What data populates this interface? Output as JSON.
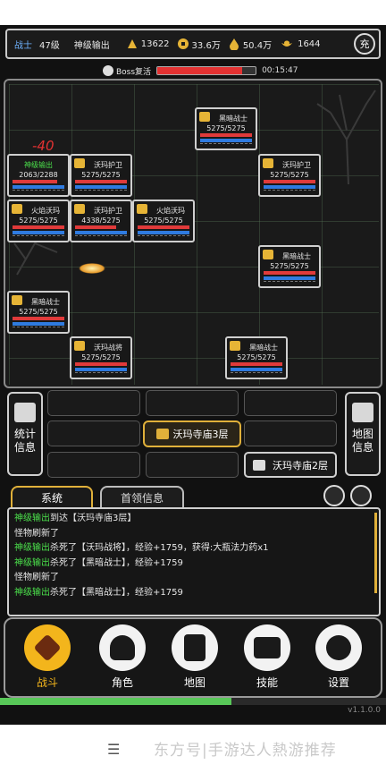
{
  "status": {
    "class": "战士",
    "level": "47级",
    "name": "神级输出",
    "res1": "13622",
    "res2": "33.6万",
    "res3": "50.4万",
    "res4": "1644",
    "auto_label": "充"
  },
  "boss": {
    "label": "Boss复活",
    "progress": 0.86,
    "timer": "00:15:47"
  },
  "damage_text": "-40",
  "units": [
    {
      "name": "黑暗战士",
      "hp": "5275/5275"
    },
    {
      "name": "神级输出",
      "hp": "2063/2288"
    },
    {
      "name": "沃玛护卫",
      "hp": "5275/5275"
    },
    {
      "name": "沃玛护卫",
      "hp": "5275/5275"
    },
    {
      "name": "火焰沃玛",
      "hp": "5275/5275"
    },
    {
      "name": "沃玛护卫",
      "hp": "4338/5275"
    },
    {
      "name": "火焰沃玛",
      "hp": "5275/5275"
    },
    {
      "name": "黑暗战士",
      "hp": "5275/5275"
    },
    {
      "name": "黑暗战士",
      "hp": "5275/5275"
    },
    {
      "name": "沃玛战将",
      "hp": "5275/5275"
    },
    {
      "name": "黑暗战士",
      "hp": "5275/5275"
    }
  ],
  "side": {
    "stats": [
      "统计",
      "信息"
    ],
    "map": [
      "地图",
      "信息"
    ]
  },
  "floors": {
    "current": "沃玛寺庙3层",
    "previous": "沃玛寺庙2层"
  },
  "tabs": [
    "系统",
    "首领信息"
  ],
  "log": [
    {
      "who": "神级输出",
      "text": "到达【沃玛寺庙3层】"
    },
    {
      "who": "",
      "text": "怪物刷新了"
    },
    {
      "who": "神级输出",
      "text": "杀死了【沃玛战将】，经验+1759，获得:大瓶法力药x1"
    },
    {
      "who": "神级输出",
      "text": "杀死了【黑暗战士】，经验+1759"
    },
    {
      "who": "",
      "text": "怪物刷新了"
    },
    {
      "who": "神级输出",
      "text": "杀死了【黑暗战士】，经验+1759"
    }
  ],
  "nav": [
    "战斗",
    "角色",
    "地图",
    "技能",
    "设置"
  ],
  "exp_progress": 0.6,
  "version": "v1.1.0.0",
  "footer": {
    "menu": "☰",
    "watermark": "东方号|手游达人熱游推荐"
  }
}
